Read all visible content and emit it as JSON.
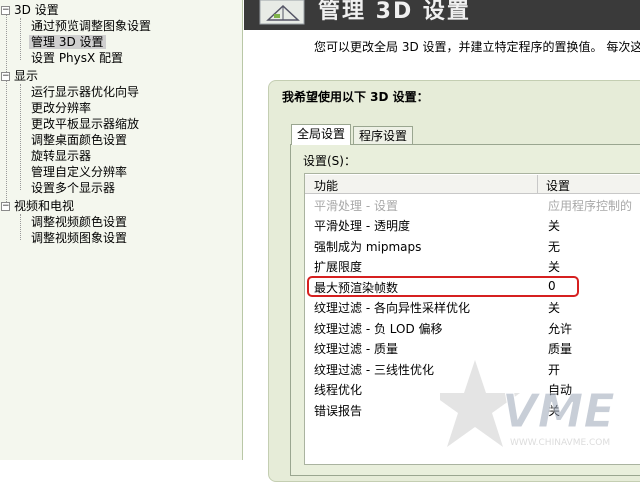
{
  "tree": {
    "sections": [
      {
        "label": "3D 设置",
        "children": [
          "通过预览调整图象设置",
          "管理 3D 设置",
          "设置 PhysX 配置"
        ]
      },
      {
        "label": "显示",
        "children": [
          "运行显示器优化向导",
          "更改分辨率",
          "更改平板显示器缩放",
          "调整桌面颜色设置",
          "旋转显示器",
          "管理自定义分辨率",
          "设置多个显示器"
        ]
      },
      {
        "label": "视频和电视",
        "children": [
          "调整视频颜色设置",
          "调整视频图象设置"
        ]
      }
    ],
    "selected": "管理 3D 设置",
    "expander_symbol": "−"
  },
  "header": {
    "title": "管理 3D 设置",
    "description": "您可以更改全局 3D 设置，并建立特定程序的置换值。 每次这"
  },
  "panel": {
    "heading": "我希望使用以下 3D 设置：",
    "tabs": [
      "全局设置",
      "程序设置"
    ],
    "active_tab": "全局设置",
    "settings_label": "设置(S)：",
    "columns": [
      "功能",
      "设置"
    ],
    "rows": [
      {
        "feature": "平滑处理 - 设置",
        "value": "应用程序控制的",
        "disabled": true
      },
      {
        "feature": "平滑处理 - 透明度",
        "value": "关"
      },
      {
        "feature": "强制成为 mipmaps",
        "value": "无"
      },
      {
        "feature": "扩展限度",
        "value": "关"
      },
      {
        "feature": "最大预渲染帧数",
        "value": "0",
        "highlighted": true
      },
      {
        "feature": "纹理过滤 - 各向异性采样优化",
        "value": "关"
      },
      {
        "feature": "纹理过滤 - 负 LOD 偏移",
        "value": "允许"
      },
      {
        "feature": "纹理过滤 - 质量",
        "value": "质量"
      },
      {
        "feature": "纹理过滤 - 三线性优化",
        "value": "开"
      },
      {
        "feature": "线程优化",
        "value": "自动"
      },
      {
        "feature": "错误报告",
        "value": "关"
      }
    ]
  },
  "watermark": {
    "brand": "VME",
    "site": "WWW.CHINAVME.COM"
  },
  "colors": {
    "highlight": "#d62020",
    "panel_bg": "#e6ecd8",
    "header_bg": "#3a3a3a"
  }
}
